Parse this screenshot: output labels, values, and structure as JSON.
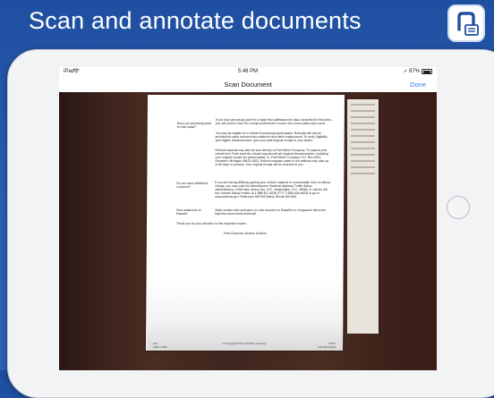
{
  "headline": "Scan and annotate documents",
  "colors": {
    "background": "#2a5eb6",
    "accent": "#2f7ff0",
    "logo": "#1f4fa0"
  },
  "status_bar": {
    "carrier": "iPad",
    "time": "5:48 PM",
    "battery": "87%"
  },
  "nav": {
    "title": "Scan Document",
    "done_label": "Done"
  },
  "document": {
    "q1": "Have you previously paid for this repair?",
    "a1": "If you have previously paid for a repair that addresses the issue described in this letter, you will need to have the receipt performed to ensure the correct parts were used.",
    "a2": "You may be eligible for a refund of previously paid repairs. Refunds will only be provided for parts and services related to door latch replacement. To verify eligibility and eligible reimbursement, give your paid original receipt to your dealer.",
    "a3": "Refund requests may also be sent directly to Ford Motor Company. To request your refund from Ford, send the refund request with all required documentation, including your original receipt (no photocopies), to: Ford Motor Company, P.O. Box 6251, Dearborn, Michigan 48121-6251. Refund requests made to the address may take up to 60 days to process. Your original receipt will be returned to you.",
    "q2": "Do you have additional concerns?",
    "a4": "If you are having difficulty getting your vehicle repaired in a reasonable time or without charge, you may write the Administrator, National Highway Traffic Safety Administration, 1200 New Jersey Ave. S.E., Washington, D.C. 20590, or call the toll-free Vehicle Safety Hotline at 1-888-327-4236 (TTY: 1-800-424-9153) or go to www.safercar.gov. Reference NHTSA Safety Recall 16V-840.",
    "q3": "Para asistencia en Español",
    "a5": "Visite nuestro sitio web para ver este anuncio en Español en el siguiente dirección: http://ow.owner.ford.com/recall",
    "thanks": "Thank you for your attention to this important matter.",
    "signature": "Ford Customer Service Division",
    "foot_left": "16V\nIN00 U 1234",
    "foot_center": "© Copyright 2016 Ford Motor Company",
    "foot_right": "17S07\nFLM-115 Stamp"
  }
}
